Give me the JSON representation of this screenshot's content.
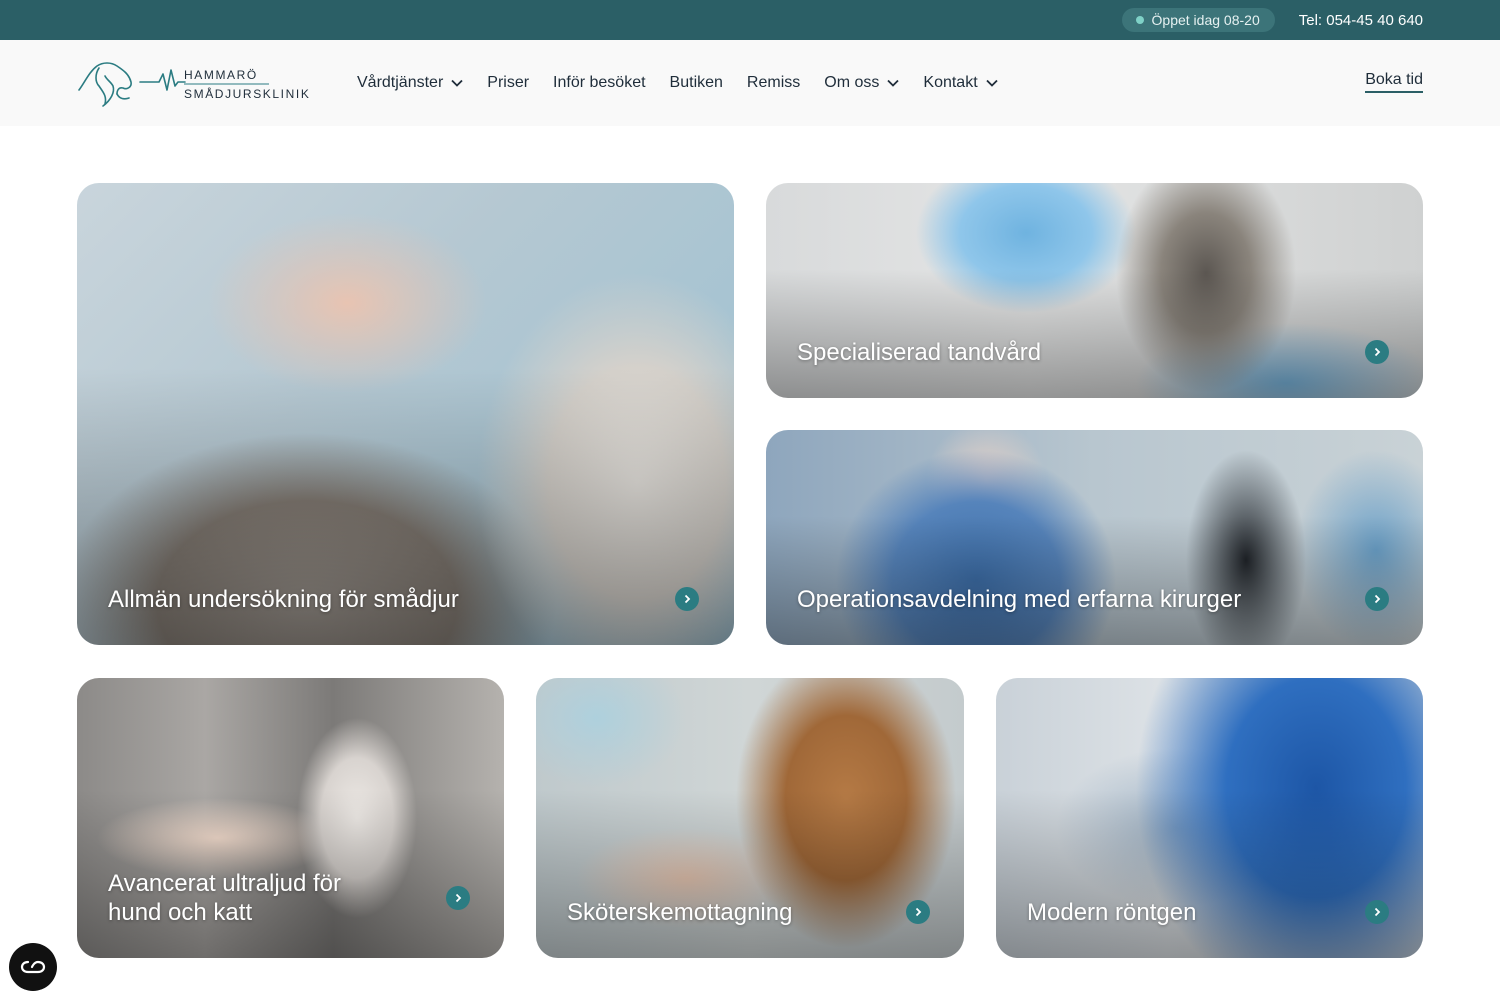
{
  "topbar": {
    "open_status": "Öppet idag 08-20",
    "phone": "Tel: 054-45 40 640"
  },
  "logo": {
    "line1": "HAMMARÖ",
    "line2": "SMÅDJURSKLINIK"
  },
  "nav": {
    "items": [
      {
        "label": "Vårdtjänster",
        "dropdown": true
      },
      {
        "label": "Priser",
        "dropdown": false
      },
      {
        "label": "Inför besöket",
        "dropdown": false
      },
      {
        "label": "Butiken",
        "dropdown": false
      },
      {
        "label": "Remiss",
        "dropdown": false
      },
      {
        "label": "Om oss",
        "dropdown": true
      },
      {
        "label": "Kontakt",
        "dropdown": true
      }
    ],
    "book_label": "Boka tid"
  },
  "cards": [
    {
      "title": "Allmän undersökning för smådjur"
    },
    {
      "title": "Specialiserad tandvård"
    },
    {
      "title": "Operationsavdelning med erfarna kirurger"
    },
    {
      "title_line1": "Avancerat ultraljud för",
      "title_line2": "hund och katt"
    },
    {
      "title": "Sköterskemottagning"
    },
    {
      "title": "Modern röntgen"
    }
  ],
  "colors": {
    "brand": "#2b5f66",
    "accent": "#2b7c82"
  }
}
